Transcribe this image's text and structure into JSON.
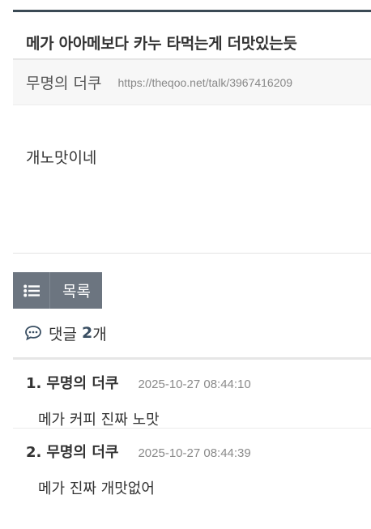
{
  "post": {
    "title": "메가 아아메보다 카누 타먹는게 더맛있는듯",
    "author": "무명의 더쿠",
    "url": "https://theqoo.net/talk/3967416209",
    "body": "개노맛이네"
  },
  "list_button": {
    "label": "목록",
    "icon": "list-icon"
  },
  "comments_header": {
    "label": "댓글",
    "count": "2",
    "suffix": "개",
    "icon": "comment-bubble-icon"
  },
  "comments": [
    {
      "num": "1.",
      "author": "무명의 더쿠",
      "date": "2025-10-27 08:44:10",
      "body": "메가 커피 진짜 노맛"
    },
    {
      "num": "2.",
      "author": "무명의 더쿠",
      "date": "2025-10-27 08:44:39",
      "body": "메가 진짜 개맛없어"
    }
  ],
  "colors": {
    "rule": "#3b4a55",
    "button_bg": "#6c7580",
    "count": "#3a4f63"
  }
}
